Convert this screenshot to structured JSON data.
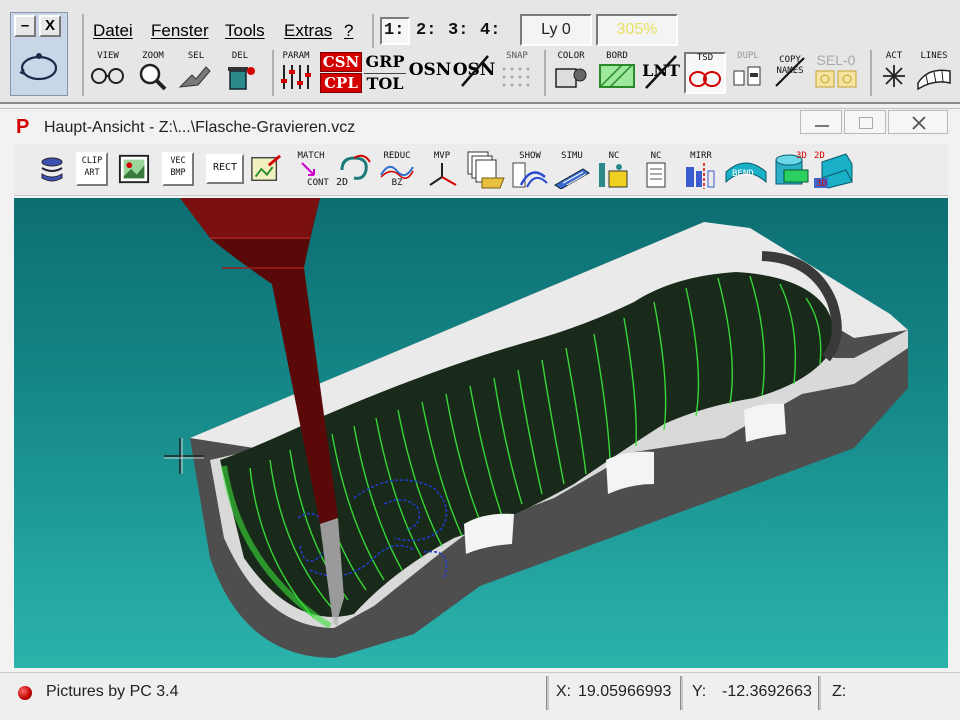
{
  "menu": {
    "minimize": "–",
    "close": "X",
    "items": [
      "Datei",
      "Fenster",
      "Tools",
      "Extras",
      "?"
    ],
    "views": [
      "1:",
      "2:",
      "3:",
      "4:"
    ],
    "layer": "Ly 0",
    "percent": "305%"
  },
  "toolbar1": {
    "view": "VIEW",
    "zoom": "ZOOM",
    "sel": "SEL",
    "del": "DEL",
    "param": "PARAM",
    "csn": "CSN",
    "cpl": "CPL",
    "grp": "GRP",
    "tol": "TOL",
    "osn1": "OSN",
    "osn2": "OSN",
    "snap": "SNAP",
    "color": "COLOR",
    "bord": "BORD",
    "lnt": "LNT",
    "tsd": "TSD",
    "dupl": "DUPL",
    "copy": "COPY",
    "names": "NAMES",
    "sel0": "SEL-0",
    "act": "ACT",
    "lines": "LINES"
  },
  "window": {
    "icon": "P",
    "title": "Haupt-Ansicht - Z:\\...\\Flasche-Gravieren.vcz"
  },
  "toolbar2": {
    "clip": "CLIP",
    "art": "ART",
    "vec": "VEC",
    "bmp": "BMP",
    "rect": "RECT",
    "match": "MATCH",
    "cont": "CONT",
    "twod": "2D",
    "reduc": "REDUC",
    "bz": "BZ",
    "mvp": "MVP",
    "show": "SHOW",
    "simu": "SIMU",
    "nc1": "NC",
    "nc2": "NC",
    "mirr": "MIRR",
    "bend": "BEND",
    "threed": "3D",
    "twod3d_a": "2D",
    "twod3d_b": "3D"
  },
  "colors": {
    "viewport_top": "#0d6e72",
    "viewport_bottom": "#2bb3ac",
    "accent_red": "#d40000",
    "toolpath_green": "#38e038"
  },
  "status": {
    "label": "Pictures by PC 3.4",
    "x_label": "X:",
    "x_value": "19.05966993",
    "y_label": "Y:",
    "y_value": "-12.3692663",
    "z_label": "Z:",
    "z_value": ""
  }
}
